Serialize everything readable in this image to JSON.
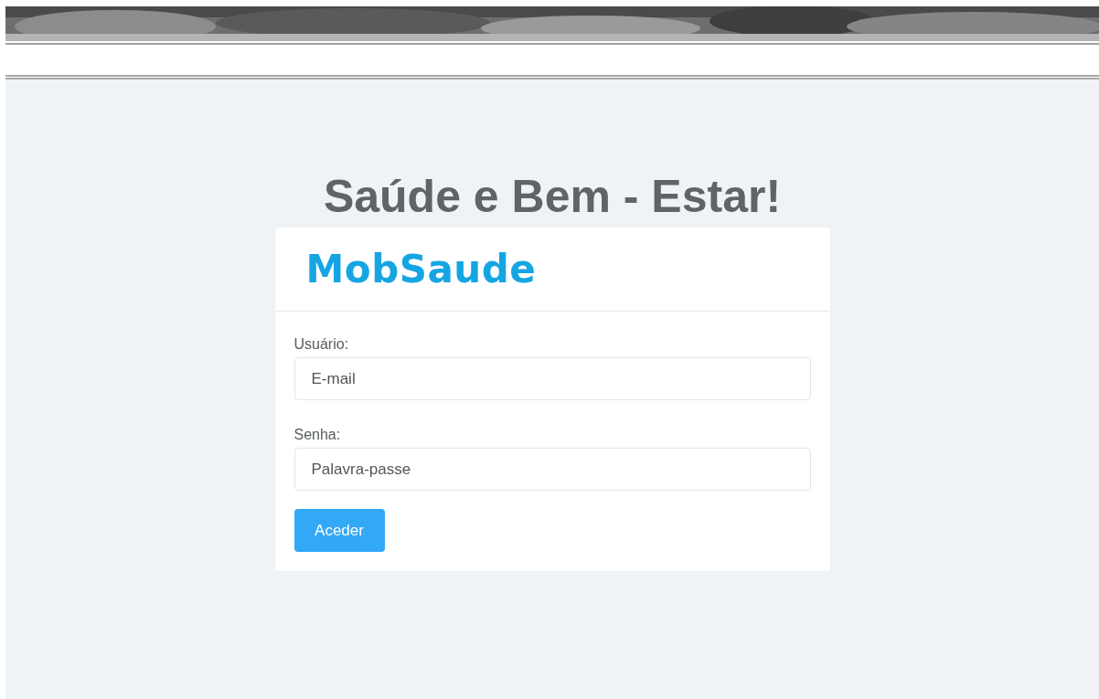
{
  "heading": "Saúde e Bem - Estar!",
  "card": {
    "logo": "MobSaude",
    "fields": [
      {
        "label": "Usuário:",
        "placeholder": "E-mail"
      },
      {
        "label": "Senha:",
        "placeholder": "Palavra-passe"
      }
    ],
    "button": "Aceder"
  }
}
